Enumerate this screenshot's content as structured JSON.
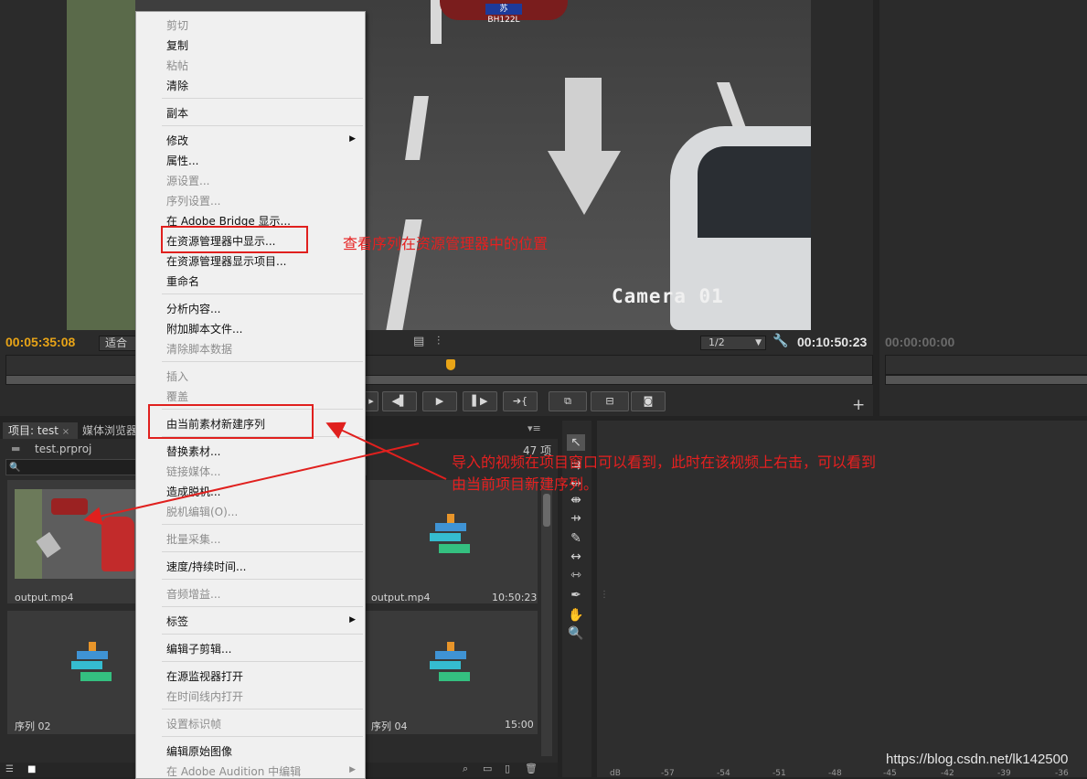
{
  "source_monitor": {
    "camera_overlay": "Camera 01",
    "plate_text": "苏BH122L",
    "timecode_in": "00:05:35:08",
    "fit_label": "适合",
    "resolution": "1/2",
    "timecode_duration": "00:10:50:23"
  },
  "program_monitor": {
    "timecode": "00:00:00:00"
  },
  "project_panel": {
    "tab_project": "项目: test",
    "tab_close": "×",
    "tab_media": "媒体浏览器",
    "filename": "test.prproj",
    "item_count": "47 项",
    "search_icon": "🔍",
    "items": [
      {
        "name": "output.mp4",
        "duration": ""
      },
      {
        "name": "output.mp4",
        "duration": "10:50:23"
      },
      {
        "name": "序列 02",
        "duration": ""
      },
      {
        "name": "序列 04",
        "duration": "15:00"
      }
    ]
  },
  "context_menu": {
    "items": [
      {
        "label": "剪切",
        "disabled": true
      },
      {
        "label": "复制",
        "disabled": false
      },
      {
        "label": "粘帖",
        "disabled": true
      },
      {
        "label": "清除",
        "disabled": false
      },
      {
        "label": "副本",
        "disabled": false
      },
      {
        "label": "修改",
        "disabled": false,
        "submenu": true
      },
      {
        "label": "属性...",
        "disabled": false
      },
      {
        "label": "源设置...",
        "disabled": true
      },
      {
        "label": "序列设置...",
        "disabled": true
      },
      {
        "label": "在 Adobe Bridge 显示...",
        "disabled": false
      },
      {
        "label": "在资源管理器中显示...",
        "disabled": false
      },
      {
        "label": "在资源管理器显示项目...",
        "disabled": false
      },
      {
        "label": "重命名",
        "disabled": false
      },
      {
        "label": "分析内容...",
        "disabled": false
      },
      {
        "label": "附加脚本文件...",
        "disabled": false
      },
      {
        "label": "清除脚本数据",
        "disabled": true
      },
      {
        "label": "插入",
        "disabled": true
      },
      {
        "label": "覆盖",
        "disabled": true
      },
      {
        "label": "由当前素材新建序列",
        "disabled": false
      },
      {
        "label": "替换素材...",
        "disabled": false
      },
      {
        "label": "链接媒体...",
        "disabled": true
      },
      {
        "label": "造成脱机...",
        "disabled": false
      },
      {
        "label": "脱机编辑(O)...",
        "disabled": true
      },
      {
        "label": "批量采集...",
        "disabled": true
      },
      {
        "label": "速度/持续时间...",
        "disabled": false
      },
      {
        "label": "音频增益...",
        "disabled": true
      },
      {
        "label": "标签",
        "disabled": false,
        "submenu": true
      },
      {
        "label": "编辑子剪辑...",
        "disabled": false
      },
      {
        "label": "在源监视器打开",
        "disabled": false
      },
      {
        "label": "在时间线内打开",
        "disabled": true
      },
      {
        "label": "设置标识帧",
        "disabled": true
      },
      {
        "label": "编辑原始图像",
        "disabled": false
      },
      {
        "label": "在 Adobe Audition 中编辑",
        "disabled": true,
        "submenu": true
      }
    ]
  },
  "annotations": {
    "show_in_explorer_note": "查看序列在资源管理器中的位置",
    "new_sequence_note_line1": "导入的视频在项目窗口可以看到，此时在该视频上右击，可以看到",
    "new_sequence_note_line2": "由当前项目新建序列。"
  },
  "audio_meter": {
    "ticks": [
      "dB",
      "-57",
      "-54",
      "-51",
      "-48",
      "-45",
      "-42",
      "-39",
      "-36"
    ]
  },
  "watermark": "https://blog.csdn.net/lk142500",
  "colors": {
    "accent_timecode": "#e8a417",
    "annotation_red": "#e0201e",
    "menu_bg": "#f0f0f0"
  }
}
